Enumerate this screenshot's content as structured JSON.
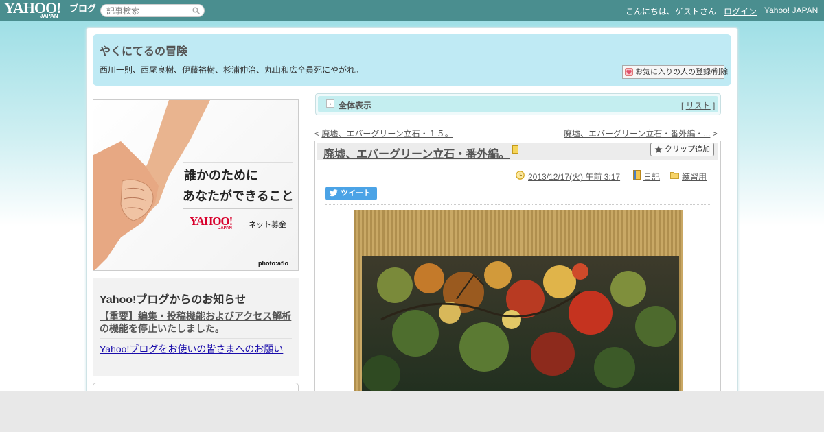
{
  "topbar": {
    "logo_main": "YAHOO!",
    "logo_sub": "JAPAN",
    "blog_word": "ブログ",
    "search_placeholder": "記事検索",
    "greeting": "こんにちは、ゲストさん",
    "login": "ログイン",
    "yahoo_japan": "Yahoo! JAPAN"
  },
  "header": {
    "title": "やくにてるの冒険",
    "description": "西川一則、西尾良樹、伊藤裕樹、杉浦伸治、丸山和広全員死にやがれ。",
    "favorite_button": "お気に入りの人の登録/削除"
  },
  "ad": {
    "line1": "誰かのために",
    "line2": "あなたができること",
    "logo": "YAHOO!",
    "logo_sub": "JAPAN",
    "bokin": "ネット募金",
    "credit": "photo:aflo"
  },
  "notice": {
    "title": "Yahoo!ブログからのお知らせ",
    "item1": "【重要】編集・投稿機能およびアクセス解析の機能を停止いたしました。",
    "item2": "Yahoo!ブログをお使いの皆さまへのお願い"
  },
  "view": {
    "label": "全体表示",
    "list_prefix": "[",
    "list_link": "リスト",
    "list_suffix": "]"
  },
  "nav": {
    "prev_mark": "<",
    "prev_title": "廃墟、エバーグリーン立石・１５。",
    "next_title": "廃墟、エバーグリーン立石・番外編・...",
    "next_mark": ">"
  },
  "article": {
    "title": "廃墟、エバーグリーン立石・番外編。",
    "clip_button": "クリップ追加",
    "date": "2013/12/17(火) 午前 3:17",
    "category1": "日記",
    "category2": "練習用",
    "tweet": "ツイート"
  },
  "colors": {
    "topbar": "#4a8e8f",
    "header_bg": "#bfeaf4",
    "tweet_blue": "#4ba3e6"
  }
}
